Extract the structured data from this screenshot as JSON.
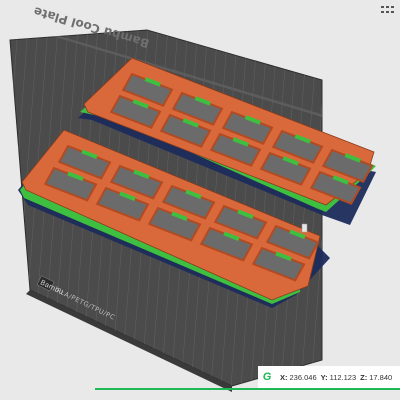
{
  "plate": {
    "side_label": "Bambu Cool Plate",
    "badge_label": "Bambu",
    "model_label": "PLA/PETG/TPU/PC"
  },
  "coords": {
    "icon": "G",
    "x_label": "X:",
    "x_value": "236.046",
    "y_label": "Y:",
    "y_value": "112.123",
    "z_label": "Z:",
    "z_value": "17.840"
  },
  "icons": {
    "coord_icon": "gcode-viewer-icon",
    "top_right": "settings-grid-icon"
  },
  "colors": {
    "plate": "#4a4a4a",
    "grid": "#6a6a6a",
    "perimeter": "#e0703a",
    "infill": "#c8502a",
    "support": "#3fbf3f",
    "shadow": "#1a2a5a",
    "accent": "#1db954"
  }
}
